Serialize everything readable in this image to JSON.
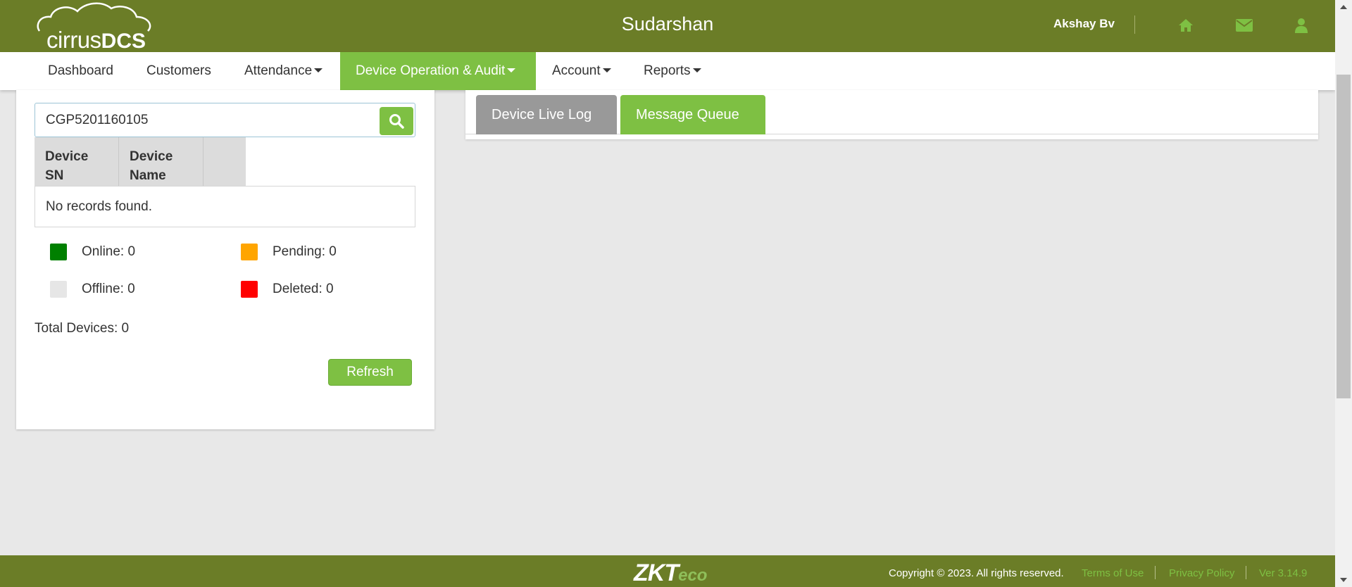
{
  "header": {
    "logo_text_light": "cirrus",
    "logo_text_bold": "DCS",
    "company_name": "Sudarshan",
    "user_name": "Akshay Bv",
    "icons": [
      "home-icon",
      "mail-icon",
      "user-icon"
    ]
  },
  "nav": {
    "items": [
      {
        "label": "Dashboard",
        "dropdown": false
      },
      {
        "label": "Customers",
        "dropdown": false
      },
      {
        "label": "Attendance",
        "dropdown": true
      },
      {
        "label": "Device Operation & Audit",
        "dropdown": true,
        "active": true
      },
      {
        "label": "Account",
        "dropdown": true
      },
      {
        "label": "Reports",
        "dropdown": true
      }
    ]
  },
  "device_panel": {
    "search_value": "CGP5201160105",
    "columns": [
      "Device SN",
      "Device Name",
      ""
    ],
    "empty_message": "No records found.",
    "legend": [
      {
        "label": "Online: 0",
        "color": "#008000"
      },
      {
        "label": "Pending: 0",
        "color": "#ffa500"
      },
      {
        "label": "Offline: 0",
        "color": "#e6e6e6"
      },
      {
        "label": "Deleted: 0",
        "color": "#ff0000"
      }
    ],
    "total_devices": "Total Devices: 0",
    "refresh_label": "Refresh"
  },
  "tabs": [
    {
      "label": "Device Live Log",
      "active": false
    },
    {
      "label": "Message Queue",
      "active": true
    }
  ],
  "footer": {
    "brand_zk": "ZKT",
    "brand_eco": "eco",
    "copyright": "Copyright © 2023. All rights reserved.",
    "links": [
      "Terms of Use",
      "Privacy Policy"
    ],
    "version": "Ver 3.14.9"
  },
  "colors": {
    "header_bg": "#6b7d27",
    "accent": "#7ec043",
    "inactive_tab": "#999999"
  }
}
